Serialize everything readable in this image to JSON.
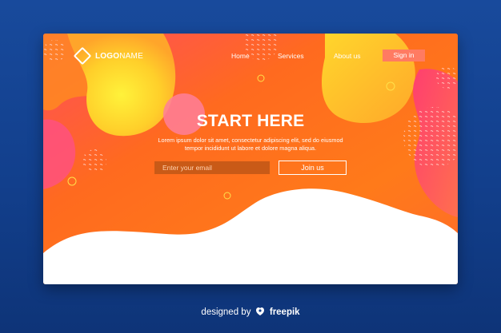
{
  "header": {
    "logo_bold": "LOGO",
    "logo_rest": "NAME",
    "nav": [
      "Home",
      "Services",
      "About us"
    ],
    "sign_in": "Sign in"
  },
  "hero": {
    "title": "START HERE",
    "subtitle_line1": "Lorem ipsum dolor sit amet, consectetur adipiscing elit, sed do eiusmod",
    "subtitle_line2": "tempor incididunt ut labore et dolore magna aliqua.",
    "email_placeholder": "Enter your email",
    "join_label": "Join us"
  },
  "footer": {
    "designed_by": "designed by",
    "brand": "freepik"
  },
  "colors": {
    "page_bg": "#184a9c",
    "hero_orange": "#ff6a1f",
    "hero_yellow": "#ffd22a",
    "hero_pink": "#ff4f7f",
    "sign_in_bg": "#ff7b62"
  },
  "icons": [
    "logo-diamond-icon",
    "freepik-logo-icon"
  ]
}
